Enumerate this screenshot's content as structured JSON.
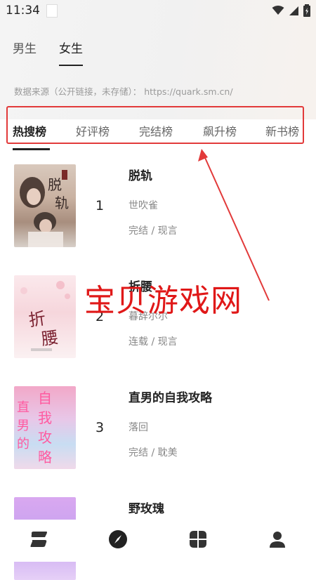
{
  "status": {
    "time": "11:34"
  },
  "gender_tabs": [
    {
      "label": "男生",
      "active": false
    },
    {
      "label": "女生",
      "active": true
    }
  ],
  "source_text": "数据来源（公开链接，未存储）： https://quark.sm.cn/",
  "rank_tabs": [
    {
      "label": "热搜榜",
      "active": true
    },
    {
      "label": "好评榜",
      "active": false
    },
    {
      "label": "完结榜",
      "active": false
    },
    {
      "label": "飙升榜",
      "active": false
    },
    {
      "label": "新书榜",
      "active": false
    }
  ],
  "books": [
    {
      "rank": "1",
      "title": "脱轨",
      "author": "世吹雀",
      "meta": "完结 / 现言",
      "cover_text": "脱轨"
    },
    {
      "rank": "2",
      "title": "折腰",
      "author": "暮辞尔尔",
      "meta": "连载 / 现言",
      "cover_text": "折腰"
    },
    {
      "rank": "3",
      "title": "直男的自我攻略",
      "author": "落回",
      "meta": "完结 / 耽美",
      "cover_text": "直男的自我攻略"
    },
    {
      "rank": "",
      "title": "野玫瑰",
      "author": "",
      "meta": "",
      "cover_text": ""
    }
  ],
  "watermark": "宝贝游戏网",
  "nav": [
    {
      "icon": "stack-icon"
    },
    {
      "icon": "compass-icon"
    },
    {
      "icon": "grid-icon"
    },
    {
      "icon": "user-icon"
    }
  ],
  "colors": {
    "highlight_box": "#e23a3a",
    "watermark": "#e01818"
  }
}
